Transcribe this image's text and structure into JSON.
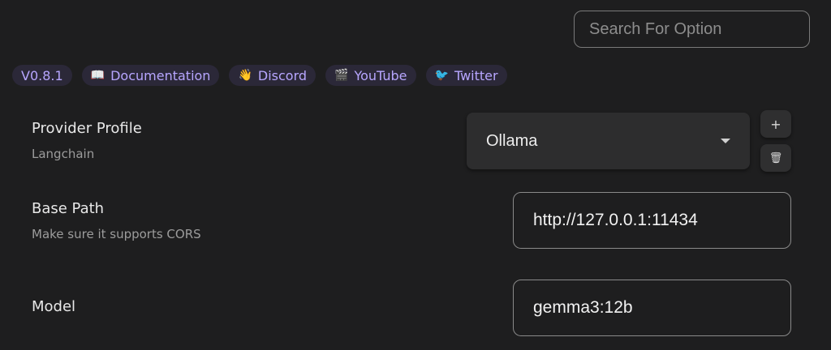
{
  "search": {
    "placeholder": "Search For Option"
  },
  "badges": [
    {
      "icon": "",
      "label": "V0.8.1"
    },
    {
      "icon": "📖",
      "label": "Documentation"
    },
    {
      "icon": "👋",
      "label": "Discord"
    },
    {
      "icon": "🎬",
      "label": "YouTube"
    },
    {
      "icon": "🐦",
      "label": "Twitter"
    }
  ],
  "provider": {
    "label": "Provider Profile",
    "sublabel": "Langchain",
    "selected": "Ollama",
    "add_icon": "+",
    "delete_icon": "🗑"
  },
  "base_path": {
    "label": "Base Path",
    "sublabel": "Make sure it supports CORS",
    "value": "http://127.0.0.1:11434"
  },
  "model": {
    "label": "Model",
    "value": "gemma3:12b"
  },
  "colors": {
    "background": "#1e1e1f",
    "badge_bg": "#2b2838",
    "badge_text": "#b7a6ff"
  }
}
